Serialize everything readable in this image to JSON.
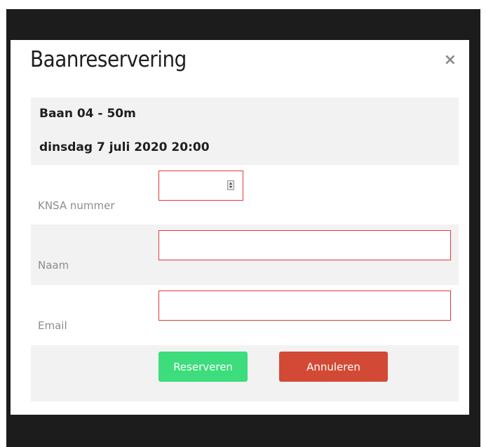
{
  "modal": {
    "title": "Baanreservering",
    "close_symbol": "×"
  },
  "info": {
    "lane": "Baan 04 - 50m",
    "datetime": "dinsdag 7 juli 2020 20:00"
  },
  "form": {
    "knsa_label": "KNSA nummer",
    "knsa_value": "",
    "name_label": "Naam",
    "name_value": "",
    "email_label": "Email",
    "email_value": ""
  },
  "buttons": {
    "reserve_label": "Reserveren",
    "cancel_label": "Annuleren"
  },
  "colors": {
    "reserve": "#3ddc7c",
    "cancel": "#d24a35",
    "invalid_border": "#e03a3a",
    "backdrop": "#1c1c1c"
  }
}
